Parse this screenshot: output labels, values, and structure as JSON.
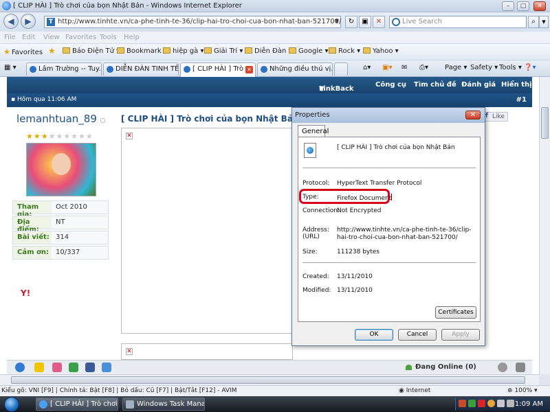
{
  "window": {
    "title": "[ CLIP HÀI ] Trò chơi của bọn Nhật Bản - Windows Internet Explorer",
    "min": "–",
    "max": "□",
    "close": "✕"
  },
  "address": {
    "back": "◀",
    "forward": "▶",
    "url": "http://www.tinhte.vn/ca-phe-tinh-te-36/clip-hai-tro-choi-cua-bon-nhat-ban-521700/",
    "site_icon": "T",
    "dropdown": "▼",
    "refresh": "↻",
    "compat": "▣",
    "stop": "✕",
    "search_placeholder": "Live Search",
    "search_go": "⌕",
    "search_dropdown": "▼"
  },
  "menu": [
    "File",
    "Edit",
    "View",
    "Favorites",
    "Tools",
    "Help"
  ],
  "favorites": {
    "label": "Favorites",
    "add_icon": "★",
    "items": [
      "Báo Điện Tử",
      "Bookmark",
      "hiệp gà",
      "Giải Trí",
      "Diễn Đàn",
      "Google",
      "Rock",
      "Yahoo"
    ]
  },
  "tabs": {
    "items": [
      {
        "label": "Lâm Trường -- Tuy..."
      },
      {
        "label": "DIỄN ĐÀN TINH TẾ"
      },
      {
        "label": "[ CLIP HÀI ] Trò ..."
      },
      {
        "label": "Những điều thú vị..."
      }
    ],
    "tools": {
      "page": "Page ▾",
      "safety": "Safety ▾",
      "tools": "Tools ▾",
      "help": "❓▾"
    }
  },
  "forum": {
    "nav": [
      "LinkBack",
      "Công cụ",
      "Tìm chủ đề",
      "Đánh giá",
      "Hiển thị"
    ],
    "post_date": "Hôm qua 11:06 AM",
    "post_number": "#1",
    "username": "lemanhtuan_89",
    "status": "○",
    "info": [
      {
        "label": "Tham gia:",
        "value": "Oct 2010"
      },
      {
        "label": "Địa điểm:",
        "value": "NT"
      },
      {
        "label": "Bài viết:",
        "value": "314"
      },
      {
        "label": "Cảm ơn:",
        "value": "10/337"
      }
    ],
    "yahoo_icon": "Y!",
    "post_title": "[ CLIP HÀI ] Trò chơi của bọn Nhật Bản",
    "like": "Like",
    "broken_img": "✕",
    "online_label": "Đang Online (0)"
  },
  "dialog": {
    "title": "Properties",
    "close": "✕",
    "tab": "General",
    "name": "[ CLIP HÀI ] Trò chơi của bọn Nhật Bản",
    "protocol_label": "Protocol:",
    "protocol_value": "HyperText Transfer Protocol",
    "type_label": "Type:",
    "type_value": "Firefox Document",
    "connection_label": "Connection:",
    "connection_value": "Not Encrypted",
    "address_label": "Address:",
    "address_label2": "(URL)",
    "address_value": "http://www.tinhte.vn/ca-phe-tinh-te-36/clip-hai-tro-choi-cua-bon-nhat-ban-521700/",
    "size_label": "Size:",
    "size_value": "111238 bytes",
    "created_label": "Created:",
    "created_value": "13/11/2010",
    "modified_label": "Modified:",
    "modified_value": "13/11/2010",
    "certificates": "Certificates",
    "ok": "OK",
    "cancel": "Cancel",
    "apply": "Apply"
  },
  "statusbar": {
    "text": "Kiểu gõ: VNI [F9] | Chính tả: Bật [F8] | Bỏ dấu: Cũ [F7] | Bật/Tắt [F12] - AVIM",
    "zone": "Internet",
    "zoom": "100%"
  },
  "taskbar": {
    "items": [
      "[ CLIP HÀI ] Trò chơi c...",
      "Windows Task Manager"
    ],
    "clock": "1:09 AM"
  },
  "colors": {
    "highlight": "#d9001b",
    "forum_nav": "#245a8c",
    "label_green": "#3c7a1f"
  }
}
